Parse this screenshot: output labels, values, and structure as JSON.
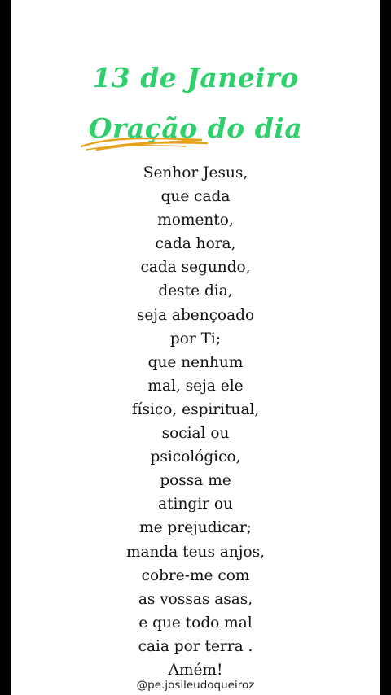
{
  "colors": {
    "title_green": "#2fcf6b",
    "swash_gold": "#e5a21a",
    "text": "#111111",
    "page_background": "#ffffff",
    "frame_background": "#000000"
  },
  "header": {
    "date_line": "13 de Janeiro",
    "prayer_title": "Oração do dia",
    "swash_icon": "gold-swash-underline"
  },
  "prayer": {
    "lines": [
      "Senhor Jesus,",
      "que cada",
      "momento,",
      "cada hora,",
      "cada segundo,",
      "deste dia,",
      "seja abençoado",
      "por Ti;",
      "que nenhum",
      "mal, seja ele",
      "físico, espiritual,",
      "social ou",
      "psicológico,",
      "possa me",
      "atingir ou",
      "me prejudicar;",
      "manda teus anjos,",
      "cobre-me com",
      "as vossas asas,",
      "e que todo mal",
      "caia por terra .",
      "Amém!"
    ]
  },
  "footer": {
    "handle": "@pe.josileudoqueiroz"
  }
}
